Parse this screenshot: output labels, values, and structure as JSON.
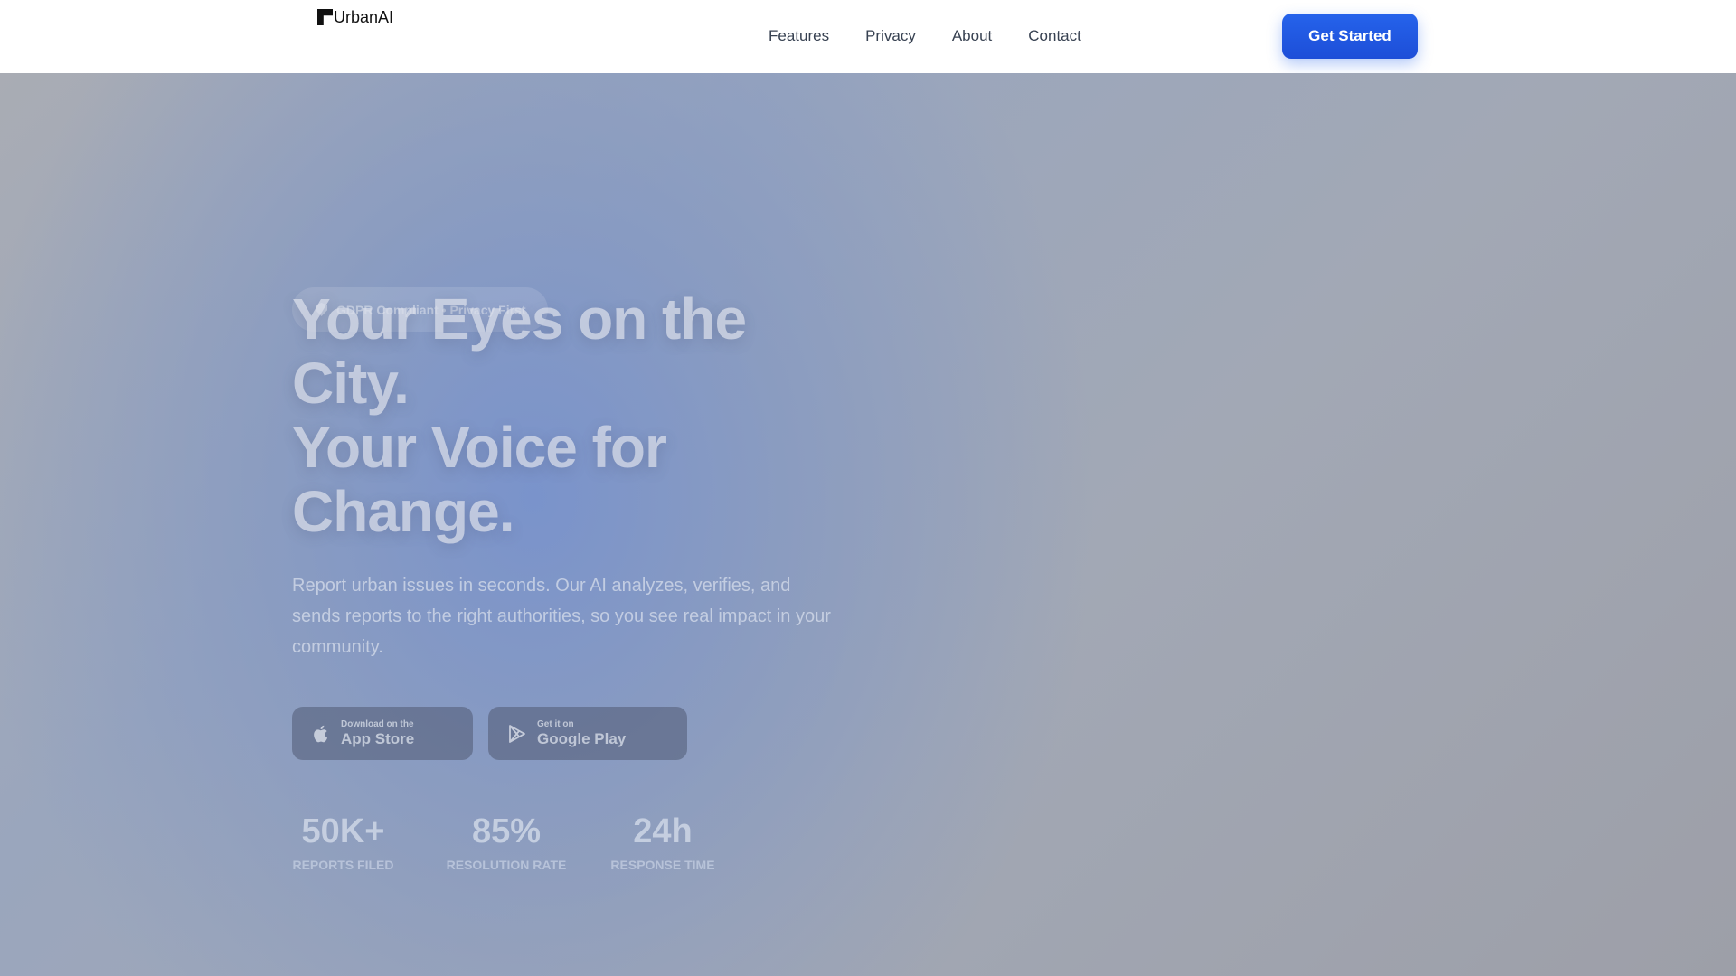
{
  "header": {
    "logo_text": "UrbanAI",
    "nav": [
      {
        "label": "Features"
      },
      {
        "label": "Privacy"
      },
      {
        "label": "About"
      },
      {
        "label": "Contact"
      }
    ],
    "cta_label": "Get Started"
  },
  "hero": {
    "badge_icon": "shield-icon",
    "badge_text": "GDPR Compliant • Privacy First",
    "headline_line1": "Your Eyes on the City.",
    "headline_line2": "Your Voice for Change.",
    "subtext": "Report urban issues in seconds. Our AI analyzes, verifies, and sends reports to the right authorities, so you see real impact in your community.",
    "app_store": {
      "icon": "apple-icon",
      "small": "Download on the",
      "big": "App Store"
    },
    "google_play": {
      "icon": "play-icon",
      "small": "Get it on",
      "big": "Google Play"
    },
    "stats": [
      {
        "value": "50K+",
        "label": "Reports Filed"
      },
      {
        "value": "85%",
        "label": "Resolution Rate"
      },
      {
        "value": "24h",
        "label": "Response Time"
      }
    ]
  },
  "colors": {
    "accent": "#2563eb",
    "nav_text": "#374151"
  }
}
